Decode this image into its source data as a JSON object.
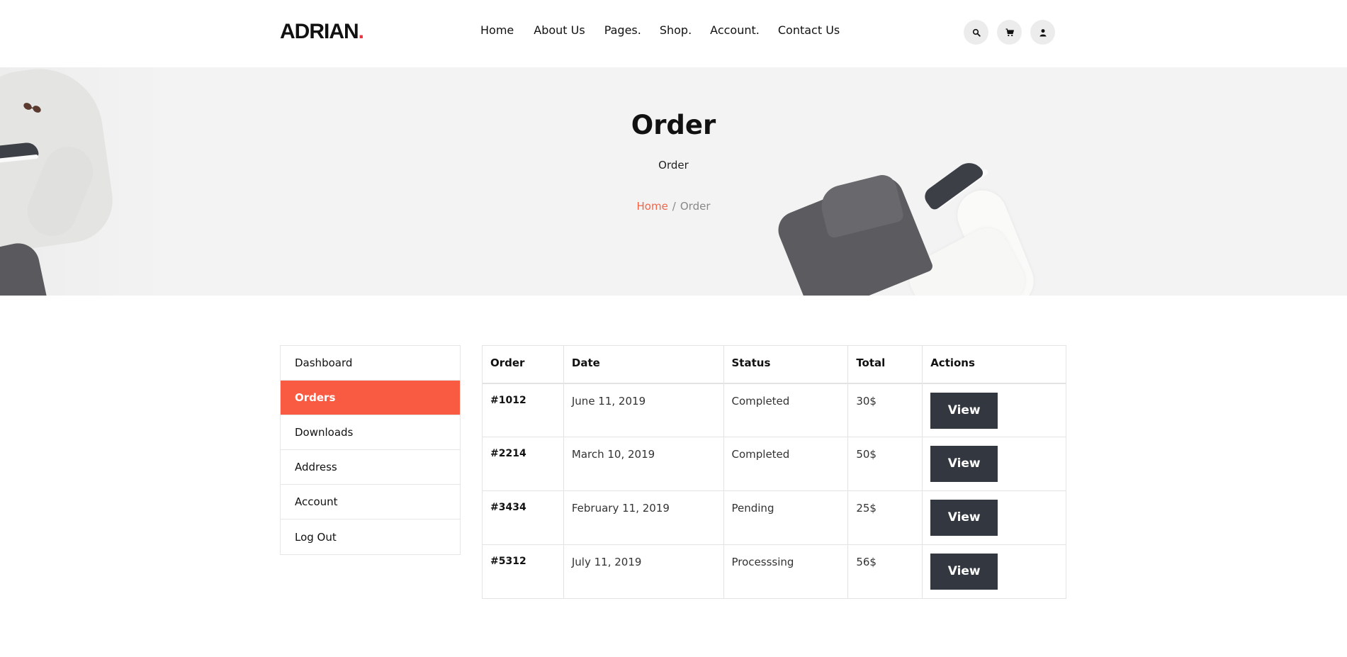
{
  "brand": {
    "name": "ADRIAN",
    "dot": ".",
    "dot_color": "#e8343f"
  },
  "nav": {
    "items": [
      {
        "label": "Home"
      },
      {
        "label": "About Us"
      },
      {
        "label": "Pages."
      },
      {
        "label": "Shop."
      },
      {
        "label": "Account."
      },
      {
        "label": "Contact Us"
      }
    ]
  },
  "header_icons": [
    "search-icon",
    "cart-icon",
    "user-icon"
  ],
  "hero": {
    "title": "Order",
    "subtitle": "Order",
    "breadcrumb": {
      "home": "Home",
      "separator": "/",
      "current": "Order"
    }
  },
  "sidebar": {
    "items": [
      {
        "label": "Dashboard",
        "active": false
      },
      {
        "label": "Orders",
        "active": true
      },
      {
        "label": "Downloads",
        "active": false
      },
      {
        "label": "Address",
        "active": false
      },
      {
        "label": "Account",
        "active": false
      },
      {
        "label": "Log Out",
        "active": false
      }
    ]
  },
  "orders_table": {
    "headers": [
      "Order",
      "Date",
      "Status",
      "Total",
      "Actions"
    ],
    "rows": [
      {
        "order": "#1012",
        "date": "June 11, 2019",
        "status": "Completed",
        "total": "30$",
        "action": "View"
      },
      {
        "order": "#2214",
        "date": "March 10, 2019",
        "status": "Completed",
        "total": "50$",
        "action": "View"
      },
      {
        "order": "#3434",
        "date": "February 11, 2019",
        "status": "Pending",
        "total": "25$",
        "action": "View"
      },
      {
        "order": "#5312",
        "date": "July 11, 2019",
        "status": "Processsing",
        "total": "56$",
        "action": "View"
      }
    ]
  },
  "colors": {
    "accent": "#f95b42",
    "breadcrumb_link": "#f26446",
    "button_dark": "#333840",
    "hero_bg": "#f3f3f3"
  }
}
